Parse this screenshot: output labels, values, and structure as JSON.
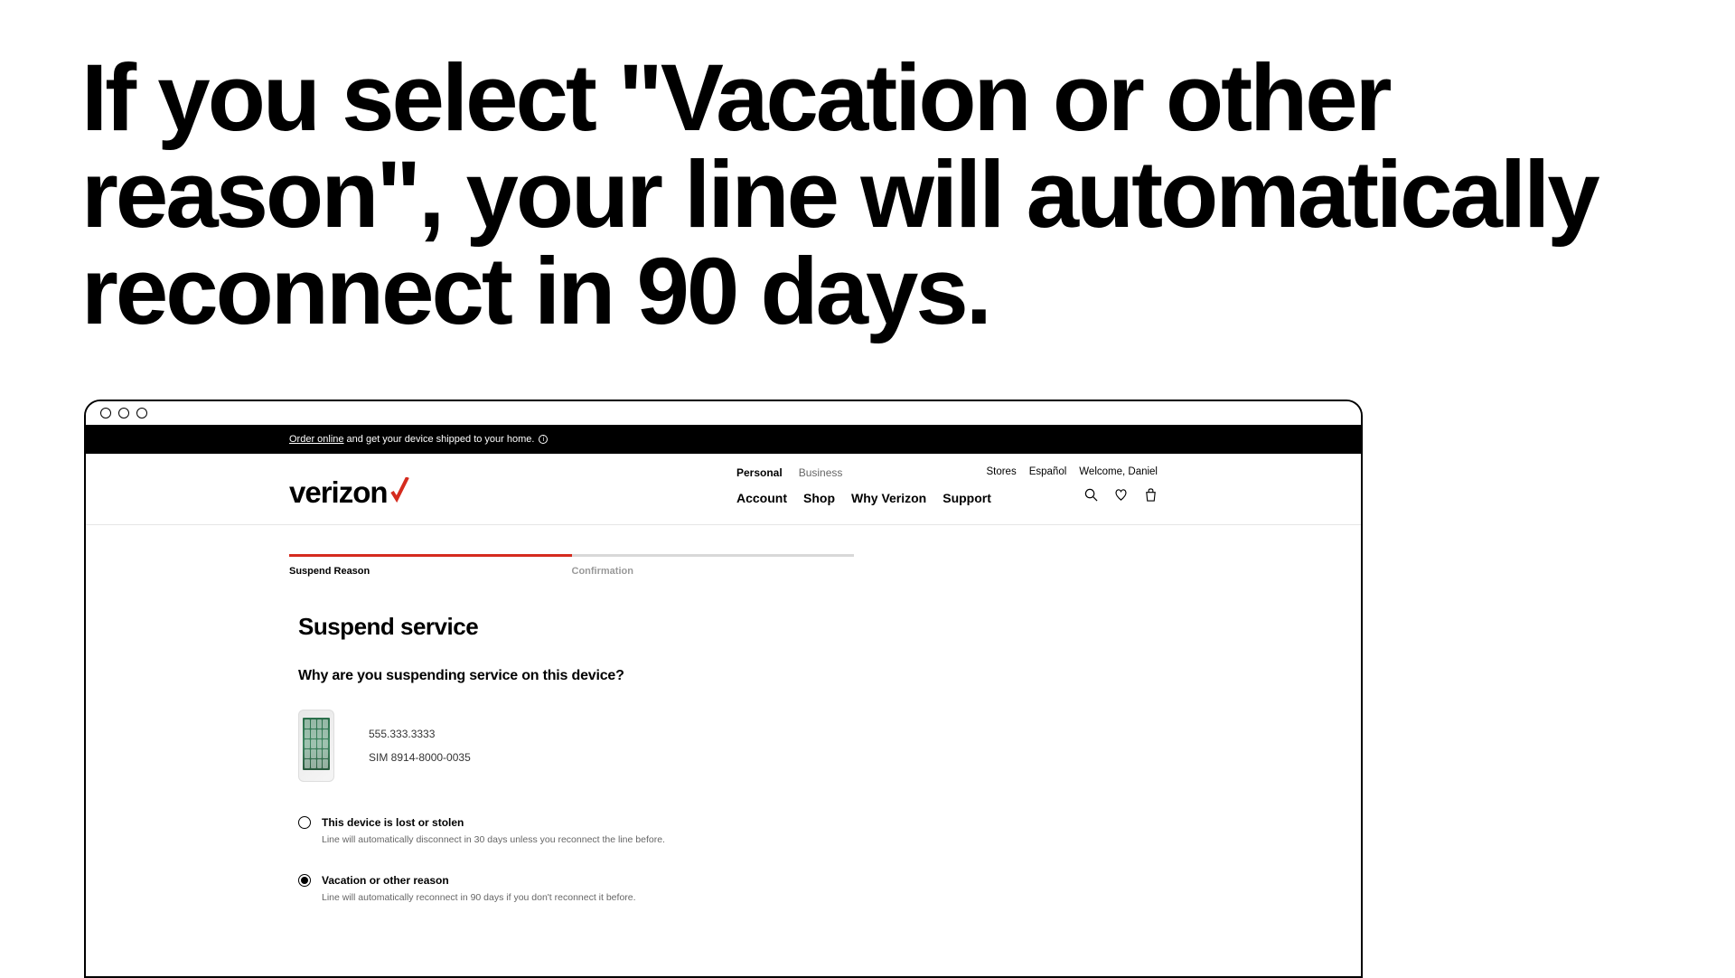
{
  "headline": "If you select \"Vacation or other reason\", your line will automatically reconnect in 90 days.",
  "promo": {
    "link_text": "Order online",
    "rest_text": "and get your device shipped to your home."
  },
  "logo_text": "verizon",
  "nav_top": {
    "personal": "Personal",
    "business": "Business"
  },
  "nav_main": {
    "account": "Account",
    "shop": "Shop",
    "why": "Why Verizon",
    "support": "Support"
  },
  "nav_right": {
    "stores": "Stores",
    "espanol": "Español",
    "welcome": "Welcome, Daniel"
  },
  "progress": {
    "step1": "Suspend Reason",
    "step2": "Confirmation"
  },
  "page_title": "Suspend service",
  "question": "Why are you suspending service on this device?",
  "device": {
    "phone": "555.333.3333",
    "sim": "SIM 8914-8000-0035"
  },
  "option1": {
    "label": "This device is lost or stolen",
    "desc": "Line will automatically disconnect in 30 days unless you reconnect the line before."
  },
  "option2": {
    "label": "Vacation or other reason",
    "desc": "Line will automatically reconnect in 90 days if you don't reconnect it before."
  }
}
